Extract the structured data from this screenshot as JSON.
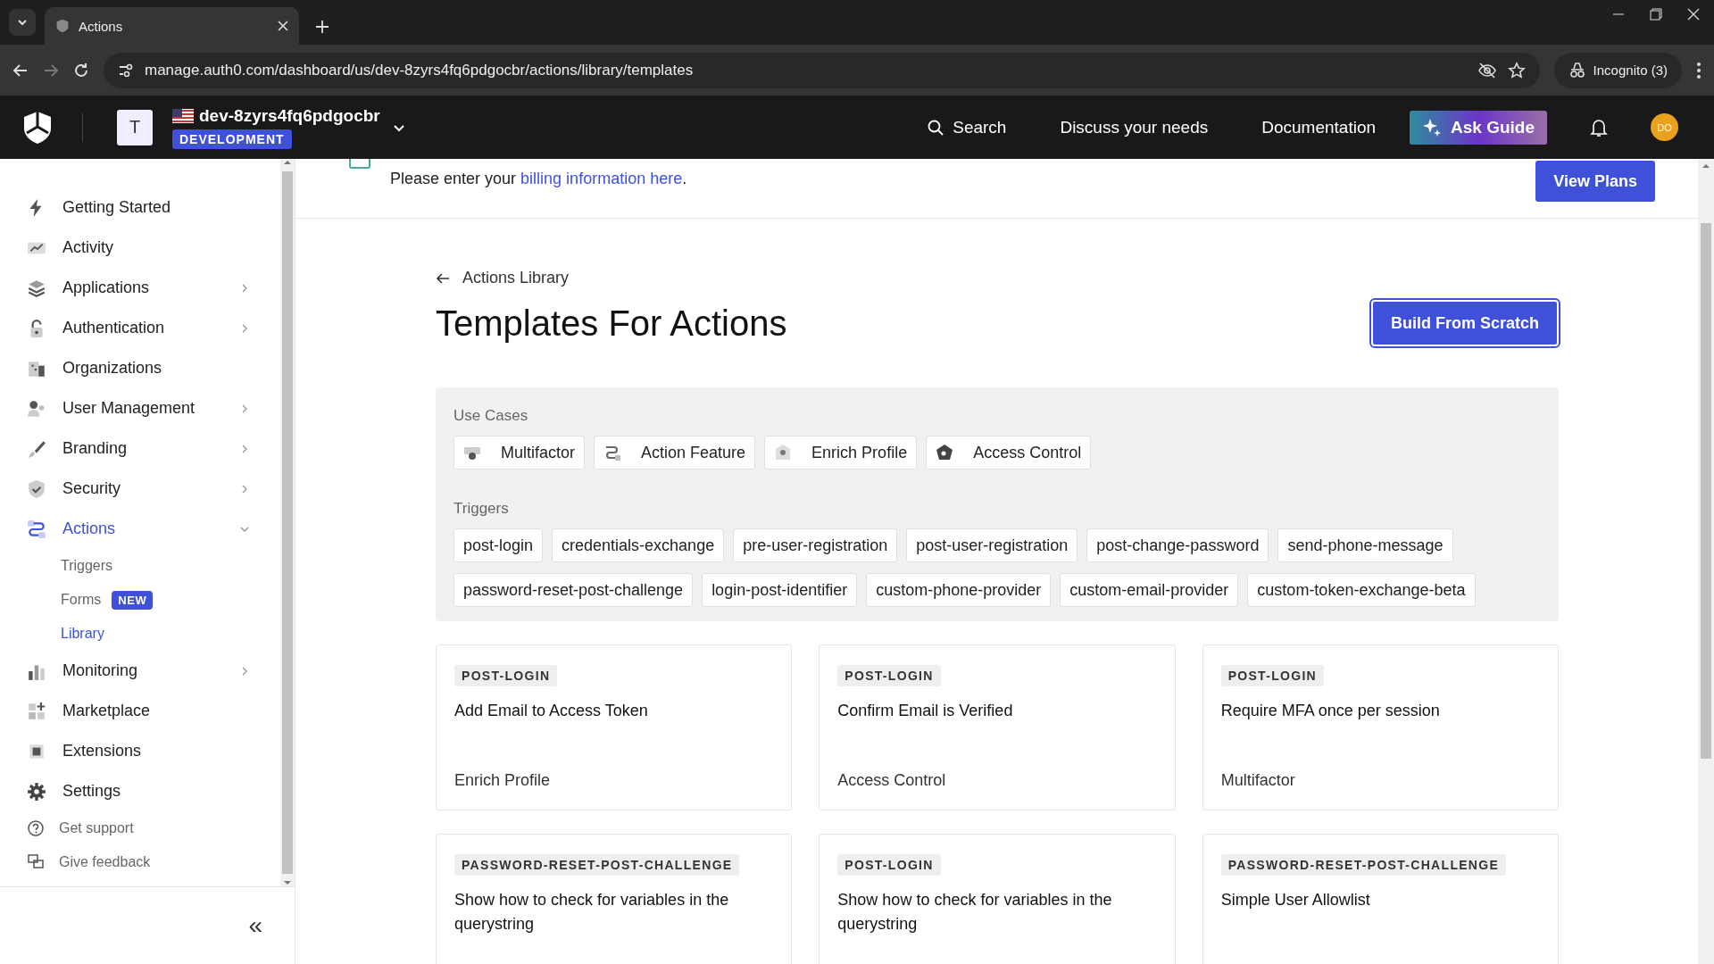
{
  "browser": {
    "tab": {
      "title": "Actions"
    },
    "url": "manage.auth0.com/dashboard/us/dev-8zyrs4fq6pdgocbr/actions/library/templates",
    "profile": "Incognito (3)"
  },
  "header": {
    "tenant_initial": "T",
    "tenant": "dev-8zyrs4fq6pdgocbr",
    "environment": "DEVELOPMENT",
    "search": "Search",
    "links": [
      "Discuss your needs",
      "Documentation"
    ],
    "ask_button": "Ask Guide",
    "avatar": "DO"
  },
  "sidebar": {
    "items": [
      {
        "kind": "bolt",
        "label": "Getting Started",
        "selected": false,
        "has_children": false
      },
      {
        "kind": "chart",
        "label": "Activity",
        "selected": false,
        "has_children": false
      },
      {
        "kind": "layers",
        "label": "Applications",
        "selected": false,
        "has_children": true
      },
      {
        "kind": "lock",
        "label": "Authentication",
        "selected": false,
        "has_children": true
      },
      {
        "kind": "building",
        "label": "Organizations",
        "selected": false,
        "has_children": false
      },
      {
        "kind": "user",
        "label": "User Management",
        "selected": false,
        "has_children": true
      },
      {
        "kind": "brush",
        "label": "Branding",
        "selected": false,
        "has_children": true
      },
      {
        "kind": "shield",
        "label": "Security",
        "selected": false,
        "has_children": true
      },
      {
        "kind": "actions",
        "label": "Actions",
        "selected": true,
        "has_children": true,
        "expanded": true,
        "children": [
          {
            "label": "Triggers",
            "selected": false
          },
          {
            "label": "Forms",
            "selected": false,
            "badge": "NEW"
          },
          {
            "label": "Library",
            "selected": true
          }
        ]
      },
      {
        "kind": "bars",
        "label": "Monitoring",
        "selected": false,
        "has_children": true
      },
      {
        "kind": "grid",
        "label": "Marketplace",
        "selected": false,
        "has_children": false
      },
      {
        "kind": "chip",
        "label": "Extensions",
        "selected": false,
        "has_children": false
      },
      {
        "kind": "gear",
        "label": "Settings",
        "selected": false,
        "has_children": false
      }
    ],
    "footer_links": [
      {
        "kind": "help",
        "label": "Get support"
      },
      {
        "kind": "feedback",
        "label": "Give feedback"
      }
    ],
    "collapse": "«"
  },
  "banner": {
    "text_before": "Please enter your ",
    "link": "billing information here",
    "text_after": ".",
    "button": "View Plans"
  },
  "breadcrumb": "Actions Library",
  "title": "Templates For Actions",
  "build_button": "Build From Scratch",
  "filters": {
    "use_cases_label": "Use Cases",
    "use_cases": [
      {
        "kind": "multifactor",
        "label": "Multifactor"
      },
      {
        "kind": "feature",
        "label": "Action Feature"
      },
      {
        "kind": "profile",
        "label": "Enrich Profile"
      },
      {
        "kind": "access",
        "label": "Access Control"
      }
    ],
    "triggers_label": "Triggers",
    "triggers": [
      "post-login",
      "credentials-exchange",
      "pre-user-registration",
      "post-user-registration",
      "post-change-password",
      "send-phone-message",
      "password-reset-post-challenge",
      "login-post-identifier",
      "custom-phone-provider",
      "custom-email-provider",
      "custom-token-exchange-beta"
    ]
  },
  "templates": [
    {
      "trigger": "POST-LOGIN",
      "title": "Add Email to Access Token",
      "use_case": "Enrich Profile"
    },
    {
      "trigger": "POST-LOGIN",
      "title": "Confirm Email is Verified",
      "use_case": "Access Control"
    },
    {
      "trigger": "POST-LOGIN",
      "title": "Require MFA once per session",
      "use_case": "Multifactor"
    },
    {
      "trigger": "PASSWORD-RESET-POST-CHALLENGE",
      "title": "Show how to check for variables in the querystring"
    },
    {
      "trigger": "POST-LOGIN",
      "title": "Show how to check for variables in the querystring"
    },
    {
      "trigger": "PASSWORD-RESET-POST-CHALLENGE",
      "title": "Simple User Allowlist"
    }
  ]
}
